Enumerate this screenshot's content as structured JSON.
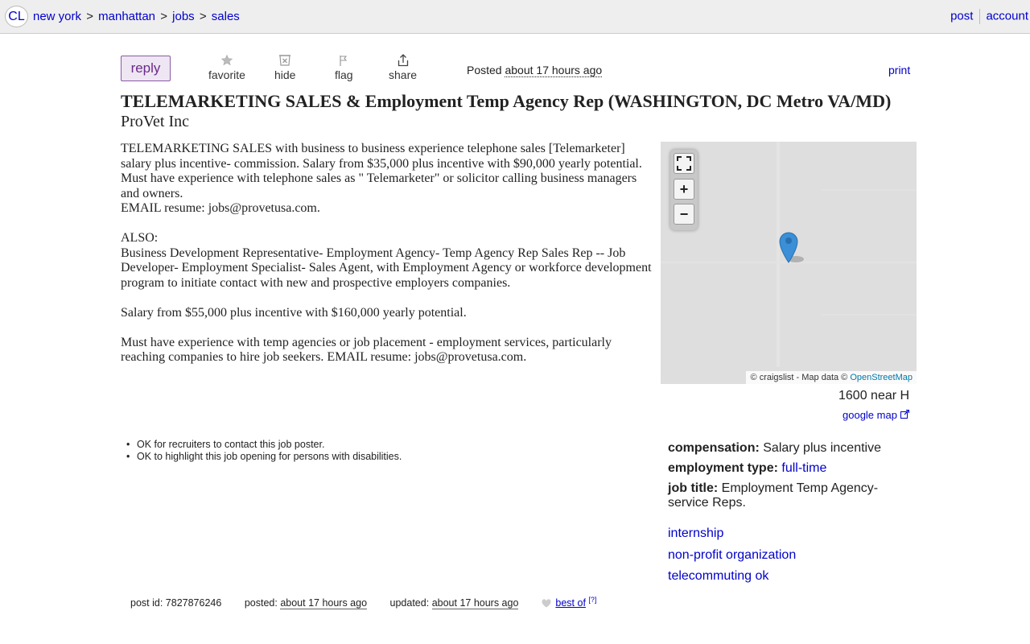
{
  "topbar": {
    "logo": "CL",
    "breadcrumbs": [
      "new york",
      "manhattan",
      "jobs",
      "sales"
    ],
    "separator": ">",
    "right_links": [
      "post",
      "account"
    ]
  },
  "actions": {
    "reply": "reply",
    "favorite": "favorite",
    "hide": "hide",
    "flag": "flag",
    "share": "share",
    "posted_prefix": "Posted",
    "posted_time": "about 17 hours ago",
    "print": "print"
  },
  "posting": {
    "title": "TELEMARKETING SALES & Employment Temp Agency Rep (WASHINGTON, DC Metro VA/MD)",
    "company": "ProVet Inc",
    "body": [
      "TELEMARKETING SALES with business to business experience telephone sales [Telemarketer] salary plus incentive- commission. Salary from $35,000 plus incentive with $90,000 yearly potential. Must have experience with telephone sales as \" Telemarketer\" or solicitor calling business managers and owners.",
      "EMAIL resume: jobs@provetusa.com.",
      "ALSO:",
      "Business Development Representative- Employment Agency- Temp Agency Rep Sales Rep -- Job Developer- Employment Specialist- Sales Agent, with Employment Agency or workforce development program to initiate contact with new and prospective employers companies.",
      "Salary from $55,000 plus incentive with $160,000 yearly potential.",
      "Must have experience with temp agencies or job placement - employment services, particularly reaching companies to hire job seekers. EMAIL resume: jobs@provetusa.com."
    ]
  },
  "map": {
    "attribution_prefix": "© craigslist - Map data ©",
    "attribution_link": "OpenStreetMap",
    "address": "1600 near H",
    "google_map": "google map",
    "fullscreen_icon": "fullscreen-icon",
    "zoom_in": "+",
    "zoom_out": "−"
  },
  "notices": [
    "OK for recruiters to contact this job poster.",
    "OK to highlight this job opening for persons with disabilities."
  ],
  "attributes": {
    "compensation_label": "compensation:",
    "compensation_value": "Salary plus incentive",
    "employment_type_label": "employment type:",
    "employment_type_value": "full-time",
    "job_title_label": "job title:",
    "job_title_value": "Employment Temp Agency- service Reps."
  },
  "tags": [
    "internship",
    "non-profit organization",
    "telecommuting ok"
  ],
  "footer": {
    "post_id_label": "post id:",
    "post_id": "7827876246",
    "posted_label": "posted:",
    "posted_time": "about 17 hours ago",
    "updated_label": "updated:",
    "updated_time": "about 17 hours ago",
    "best_of": "best of",
    "help_mark": "[?]"
  },
  "colors": {
    "link": "#0000cc",
    "topbar_bg": "#eeeeee",
    "reply_bg": "#eee6f2",
    "reply_border": "#8a5aa6",
    "map_bg": "#dedede",
    "pin": "#3a8fd6"
  }
}
